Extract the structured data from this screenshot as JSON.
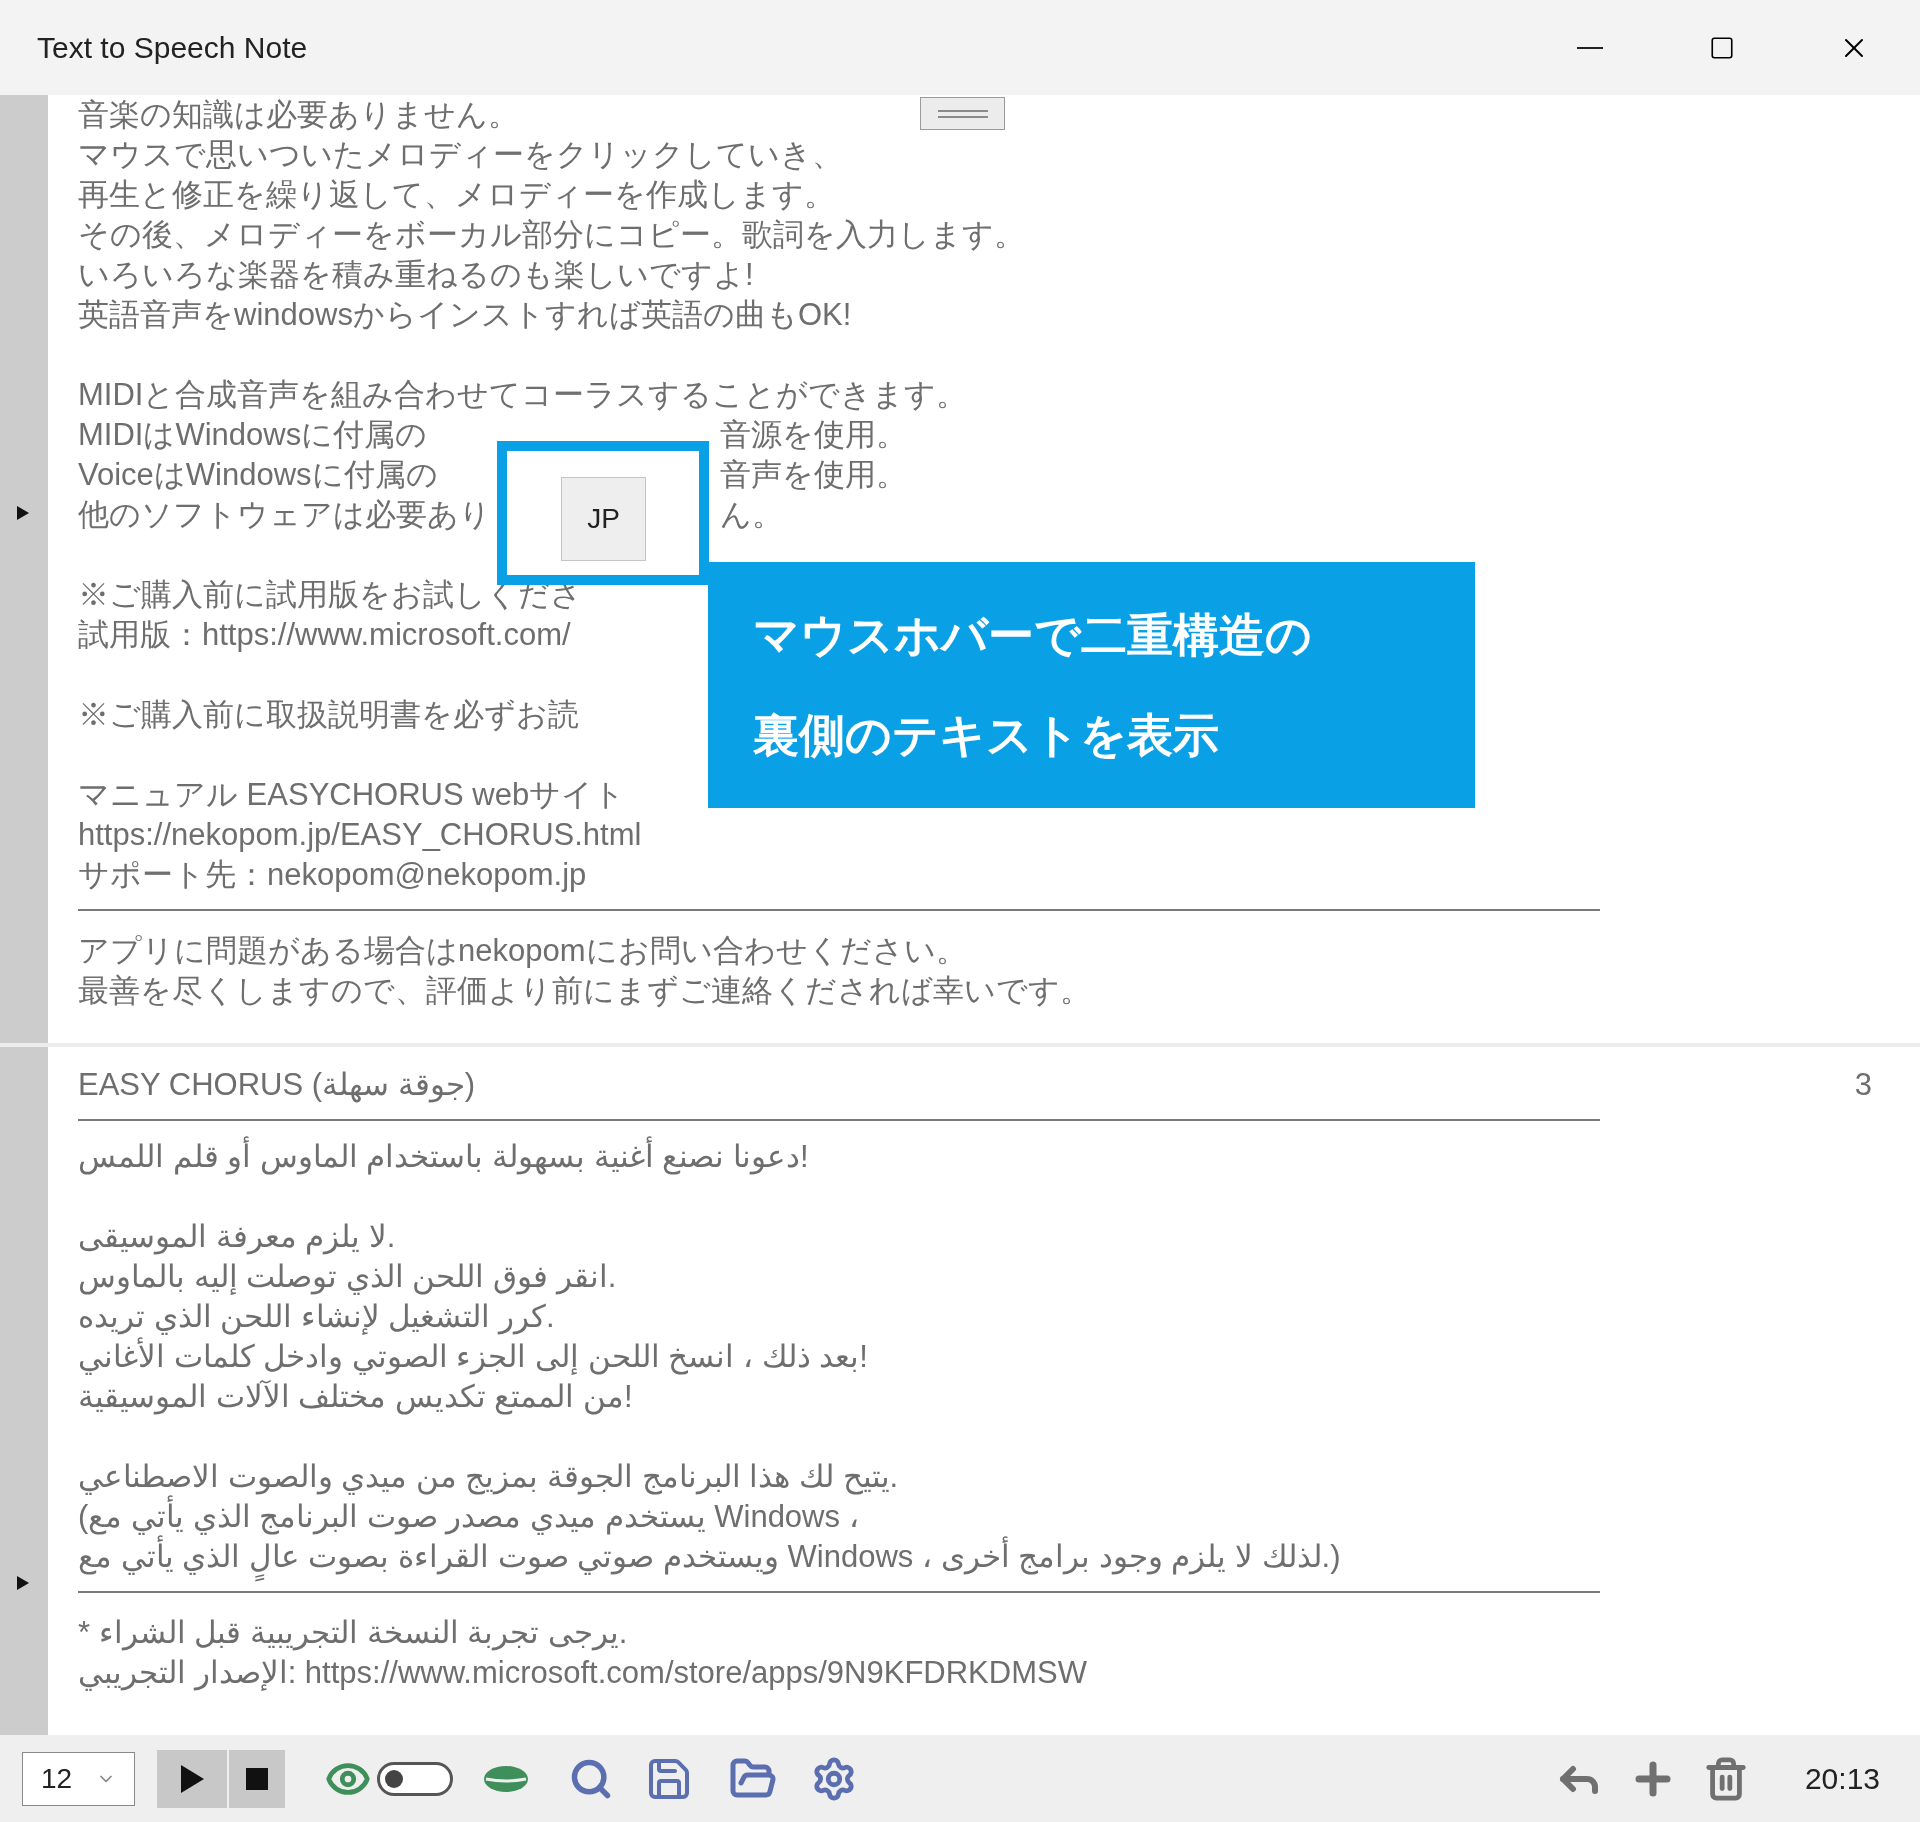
{
  "window": {
    "title": "Text to Speech Note"
  },
  "notes": [
    {
      "sections": [
        {
          "paragraphs": [
            [
              "音楽の知識は必要ありません。",
              "マウスで思いついたメロディーをクリックしていき、",
              "再生と修正を繰り返して、メロディーを作成します。",
              "その後、メロディーをボーカル部分にコピー。歌詞を入力します。",
              "いろいろな楽器を積み重ねるのも楽しいですよ!",
              "英語音声をwindowsからインストすれば英語の曲もOK!"
            ],
            [
              "MIDIと合成音声を組み合わせてコーラスすることができます。",
              {
                "visible_start": "MIDIはWindowsに付属の",
                "visible_end": "音源を使用。"
              },
              {
                "visible_start": "VoiceはWindowsに付属の",
                "visible_end": "音声を使用。"
              },
              {
                "visible_start": "他のソフトウェアは必要あり",
                "visible_end": "ん。"
              }
            ],
            [
              "※ご購入前に試用版をお試しくださ",
              "試用版：https://www.microsoft.com/"
            ],
            [
              "※ご購入前に取扱説明書を必ずお読"
            ],
            [
              "マニュアル EASYCHORUS webサイト",
              "https://nekopom.jp/EASY_CHORUS.html",
              "サポート先：nekopom@nekopom.jp"
            ]
          ]
        },
        {
          "paragraphs": [
            [
              "アプリに問題がある場合はnekopomにお問い合わせください。",
              "最善を尽くしますので、評価より前にまずご連絡くだされば幸いです。"
            ]
          ]
        }
      ]
    },
    {
      "title": "EASY CHORUS (جوقة سهلة)",
      "number": "3",
      "sections": [
        {
          "paragraphs": [
            [
              "دعونا نصنع أغنية بسهولة باستخدام الماوس أو قلم اللمس!"
            ],
            [
              "لا يلزم معرفة الموسيقى.",
              "انقر فوق اللحن الذي توصلت إليه بالماوس.",
              "كرر التشغيل لإنشاء اللحن الذي تريده.",
              "بعد ذلك ، انسخ اللحن إلى الجزء الصوتي وادخل كلمات الأغاني!",
              "من الممتع تكديس مختلف الآلات الموسيقية!"
            ],
            [
              "يتيح لك هذا البرنامج الجوقة بمزيج من ميدي والصوت الاصطناعي.",
              "(يستخدم ميدي مصدر صوت البرنامج الذي يأتي مع Windows ،",
              "ويستخدم صوتي صوت القراءة بصوت عالٍ الذي يأتي مع Windows ، لذلك لا يلزم وجود برامج أخرى.)"
            ]
          ]
        },
        {
          "paragraphs": [
            [
              "* يرجى تجربة النسخة التجريبية قبل الشراء.",
              "الإصدار التجريبي: https://www.microsoft.com/store/apps/9N9KFDRKDMSW"
            ]
          ]
        }
      ]
    }
  ],
  "hover_button": {
    "label": "JP"
  },
  "annotation": {
    "lines": [
      "マウスホバーで二重構造の",
      "裏側のテキストを表示"
    ]
  },
  "toolbar": {
    "font_size": "12",
    "voice_toggle": {
      "on": false
    },
    "time": "20:13"
  }
}
